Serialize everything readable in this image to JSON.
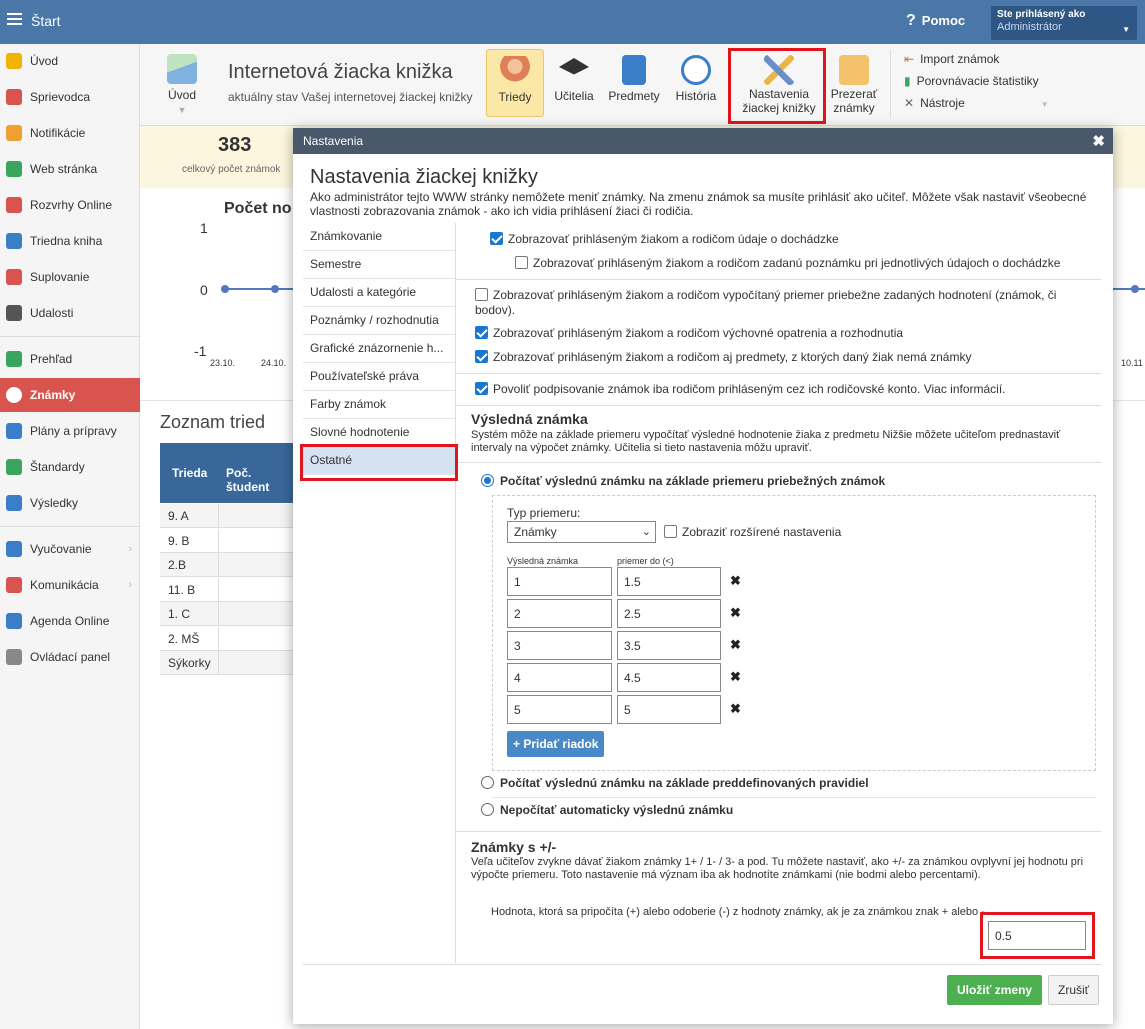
{
  "topbar": {
    "title": "Štart",
    "help": "Pomoc",
    "user_label": "Ste prihlásený ako",
    "user_name": "Administrátor"
  },
  "sidebar": {
    "items": [
      {
        "label": "Úvod",
        "color": "#f0b400"
      },
      {
        "label": "Sprievodca",
        "color": "#d9534f"
      },
      {
        "label": "Notifikácie",
        "color": "#f0a030"
      },
      {
        "label": "Web stránka",
        "color": "#3aa55e"
      },
      {
        "label": "Rozvrhy Online",
        "color": "#d9534f"
      },
      {
        "label": "Triedna kniha",
        "color": "#3a7dc9"
      },
      {
        "label": "Suplovanie",
        "color": "#d9534f"
      },
      {
        "label": "Udalosti",
        "color": "#555555"
      },
      {
        "label": "Prehľad",
        "color": "#3aa55e"
      },
      {
        "label": "Známky",
        "color": "#d9534f"
      },
      {
        "label": "Plány a prípravy",
        "color": "#3a7dc9"
      },
      {
        "label": "Štandardy",
        "color": "#3aa55e"
      },
      {
        "label": "Výsledky",
        "color": "#3a7dc9"
      },
      {
        "label": "Vyučovanie",
        "color": "#3a7dc9"
      },
      {
        "label": "Komunikácia",
        "color": "#d9534f"
      },
      {
        "label": "Agenda Online",
        "color": "#3a7dc9"
      },
      {
        "label": "Ovládací panel",
        "color": "#888888"
      }
    ]
  },
  "ribbon": {
    "home": "Úvod",
    "title": "Internetová žiacka knižka",
    "subtitle": "aktuálny stav Vašej internetovej žiackej knižky",
    "btn_triedy": "Triedy",
    "btn_ucitelia": "Učitelia",
    "btn_predmety": "Predmety",
    "btn_historia": "História",
    "btn_nastavenia_1": "Nastavenia",
    "btn_nastavenia_2": "žiackej knižky",
    "btn_prezerat_1": "Prezerať",
    "btn_prezerat_2": "známky",
    "import": "Import známok",
    "porovnavacie": "Porovnávacie štatistiky",
    "nastroje": "Nástroje"
  },
  "background": {
    "stat_value": "383",
    "stat_label": "celkový počet známok",
    "chart_title": "Počet no",
    "y1": "1",
    "y0": "0",
    "ym1": "-1",
    "x1": "23.10.",
    "x2": "24.10.",
    "x3": "10.11",
    "list_title": "Zoznam tried",
    "col_trieda": "Trieda",
    "col_poc": "Poč. študent",
    "classes": [
      "9. A",
      "9. B",
      "2.B",
      "11. B",
      "1. C",
      "2. MŠ",
      "Sýkorky"
    ]
  },
  "modal": {
    "header": "Nastavenia",
    "title": "Nastavenia žiackej knižky",
    "description": "Ako administrátor tejto WWW stránky nemôžete meniť známky. Na zmenu známok sa musíte prihlásiť ako učiteľ. Môžete však nastaviť všeobecné vlastnosti zobrazovania známok - ako ich vidia prihlásení žiaci či rodičia.",
    "nav": [
      "Známkovanie",
      "Semestre",
      "Udalosti a kategórie",
      "Poznámky / rozhodnutia",
      "Grafické znázornenie h...",
      "Používateľské práva",
      "Farby známok",
      "Slovné hodnotenie",
      "Ostatné"
    ],
    "cb1": "Zobrazovať prihláseným žiakom a rodičom údaje o dochádzke",
    "cb2": "Zobrazovať prihláseným žiakom a rodičom zadanú poznámku pri jednotlivých údajoch o dochádzke",
    "cb3a": "Zobrazovať prihláseným žiakom a rodičom vypočítaný priemer priebežne zadaných hodnotení (známok, či",
    "cb3b": "bodov).",
    "cb4": "Zobrazovať prihláseným žiakom a rodičom výchovné opatrenia a rozhodnutia",
    "cb5": "Zobrazovať prihláseným žiakom a rodičom aj predmety, z ktorých daný žiak nemá známky",
    "cb6": "Povoliť podpisovanie známok iba rodičom prihláseným cez ich rodičovské konto. Viac informácií.",
    "vysledna_title": "Výsledná známka",
    "vysledna_desc": "Systém môže na základe priemeru vypočítať výsledné hodnotenie žiaka z predmetu Nižšie môžete učiteľom prednastaviť intervaly na výpočet známky. Učitelia si tieto nastavenia môžu upraviť.",
    "radio1": "Počítať výslednú známku na základe priemeru priebežných známok",
    "typ_priemeru": "Typ priemeru:",
    "typ_value": "Známky",
    "rozsirene": "Zobraziť rozšírené nastavenia",
    "col_vysledna": "Výsledná známka",
    "col_priemer": "priemer do (<)",
    "grades": [
      {
        "g": "1",
        "p": "1.5"
      },
      {
        "g": "2",
        "p": "2.5"
      },
      {
        "g": "3",
        "p": "3.5"
      },
      {
        "g": "4",
        "p": "4.5"
      },
      {
        "g": "5",
        "p": "5"
      }
    ],
    "add_row": "+ Pridať riadok",
    "radio2": "Počítať výslednú známku na základe preddefinovaných pravidiel",
    "radio3": "Nepočítať automaticky výslednú známku",
    "pm_title": "Známky s +/-",
    "pm_desc": "Veľa učiteľov zvykne dávať žiakom známky 1+ / 1- / 3- a pod. Tu môžete nastaviť, ako +/- za známkou ovplyvní jej hodnotu pri výpočte priemeru. Toto nastavenie má význam iba ak hodnotíte známkami (nie bodmi alebo percentami).",
    "pm_label": "Hodnota, ktorá sa pripočíta (+) alebo odoberie (-) z hodnoty známky, ak je za známkou znak + alebo -",
    "pm_value": "0.5",
    "save": "Uložiť zmeny",
    "cancel": "Zrušiť"
  }
}
